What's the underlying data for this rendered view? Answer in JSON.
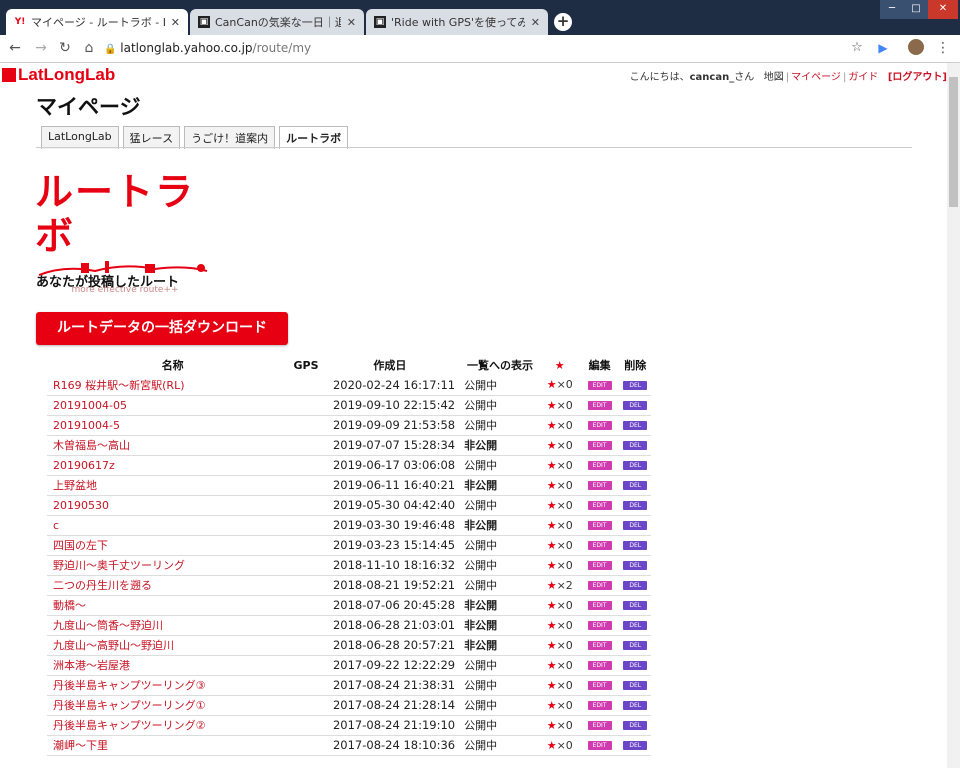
{
  "browser": {
    "tabs": [
      {
        "title": "マイページ - ルートラボ - LatL",
        "active": true
      },
      {
        "title": "CanCanの気楽な一日｜退屈を",
        "active": false
      },
      {
        "title": "'Ride with GPS'を使ってみまし",
        "active": false
      }
    ],
    "url_host": "latlonglab.yahoo.co.jp",
    "url_path": "/route/my"
  },
  "site": {
    "logo": "LatLongLab",
    "greeting_prefix": "こんにちは、",
    "user": "cancan_",
    "greeting_suffix": "さん",
    "nav_map": "地図",
    "nav_mypage": "マイページ",
    "nav_guide": "ガイド",
    "nav_logout": "[ログアウト]"
  },
  "page": {
    "title": "マイページ",
    "tabs": [
      "LatLongLab",
      "猛レース",
      "うごけ！道案内",
      "ルートラボ"
    ],
    "service_logo": "ルートラボ",
    "service_tagline": "more effective route++",
    "section_heading": "あなたが投稿したルート",
    "download_button": "ルートデータの一括ダウンロード"
  },
  "table": {
    "headers": {
      "name": "名称",
      "gps": "GPS",
      "created": "作成日",
      "listing": "一覧への表示",
      "star": "★",
      "edit": "編集",
      "delete": "削除"
    },
    "edit_label": "EDIT",
    "delete_label": "DEL",
    "rows": [
      {
        "name": "R169 桜井駅～新宮駅(RL)",
        "date": "2020-02-24 16:17:11",
        "status": "公開中",
        "stars": "★×0"
      },
      {
        "name": "20191004-05",
        "date": "2019-09-10 22:15:42",
        "status": "公開中",
        "stars": "★×0"
      },
      {
        "name": "20191004-5",
        "date": "2019-09-09 21:53:58",
        "status": "公開中",
        "stars": "★×0"
      },
      {
        "name": "木曽福島～高山",
        "date": "2019-07-07 15:28:34",
        "status": "非公開",
        "stars": "★×0"
      },
      {
        "name": "20190617z",
        "date": "2019-06-17 03:06:08",
        "status": "公開中",
        "stars": "★×0"
      },
      {
        "name": "上野盆地",
        "date": "2019-06-11 16:40:21",
        "status": "非公開",
        "stars": "★×0"
      },
      {
        "name": "20190530",
        "date": "2019-05-30 04:42:40",
        "status": "公開中",
        "stars": "★×0"
      },
      {
        "name": "c",
        "date": "2019-03-30 19:46:48",
        "status": "非公開",
        "stars": "★×0"
      },
      {
        "name": "四国の左下",
        "date": "2019-03-23 15:14:45",
        "status": "公開中",
        "stars": "★×0"
      },
      {
        "name": "野迫川～奥千丈ツーリング",
        "date": "2018-11-10 18:16:32",
        "status": "公開中",
        "stars": "★×0"
      },
      {
        "name": "二つの丹生川を遡る",
        "date": "2018-08-21 19:52:21",
        "status": "公開中",
        "stars": "★×2"
      },
      {
        "name": "動橋～",
        "date": "2018-07-06 20:45:28",
        "status": "非公開",
        "stars": "★×0"
      },
      {
        "name": "九度山～筒香～野迫川",
        "date": "2018-06-28 21:03:01",
        "status": "非公開",
        "stars": "★×0"
      },
      {
        "name": "九度山～高野山～野迫川",
        "date": "2018-06-28 20:57:21",
        "status": "非公開",
        "stars": "★×0"
      },
      {
        "name": "洲本港～岩屋港",
        "date": "2017-09-22 12:22:29",
        "status": "公開中",
        "stars": "★×0"
      },
      {
        "name": "丹後半島キャンプツーリング③",
        "date": "2017-08-24 21:38:31",
        "status": "公開中",
        "stars": "★×0"
      },
      {
        "name": "丹後半島キャンプツーリング①",
        "date": "2017-08-24 21:28:14",
        "status": "公開中",
        "stars": "★×0"
      },
      {
        "name": "丹後半島キャンプツーリング②",
        "date": "2017-08-24 21:19:10",
        "status": "公開中",
        "stars": "★×0"
      },
      {
        "name": "潮岬～下里",
        "date": "2017-08-24 18:10:36",
        "status": "公開中",
        "stars": "★×0"
      }
    ]
  }
}
